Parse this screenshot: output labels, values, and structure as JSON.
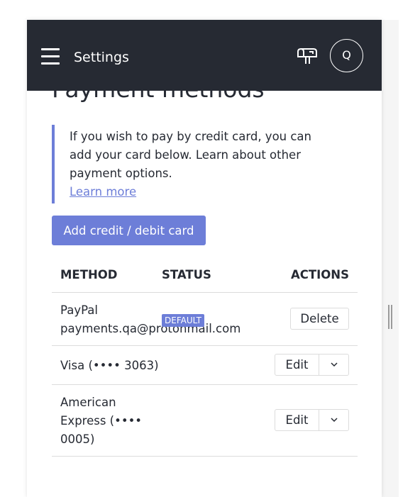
{
  "header": {
    "title": "Settings",
    "avatar_initial": "Q",
    "icons": {
      "menu": "hamburger-icon",
      "mailbox": "mailbox-icon"
    },
    "background": "#262a33"
  },
  "page": {
    "heading": "Payment methods"
  },
  "info": {
    "text": "If you wish to pay by credit card, you can add your card below. Learn about other payment options.",
    "link": "Learn more"
  },
  "add_button": {
    "label": "Add credit / debit card"
  },
  "table": {
    "headers": {
      "method": "METHOD",
      "status": "STATUS",
      "actions": "ACTIONS"
    },
    "rows": [
      {
        "method": "PayPal payments.qa@protonmail.com",
        "status": "DEFAULT",
        "action": "Delete"
      },
      {
        "method": "Visa (•••• 3063)",
        "status": "",
        "action": "Edit"
      },
      {
        "method": "American Express (•••• 0005)",
        "status": "",
        "action": "Edit"
      }
    ]
  },
  "colors": {
    "accent": "#6d7ed8",
    "text": "#262a33",
    "border": "#dcdcdc"
  }
}
